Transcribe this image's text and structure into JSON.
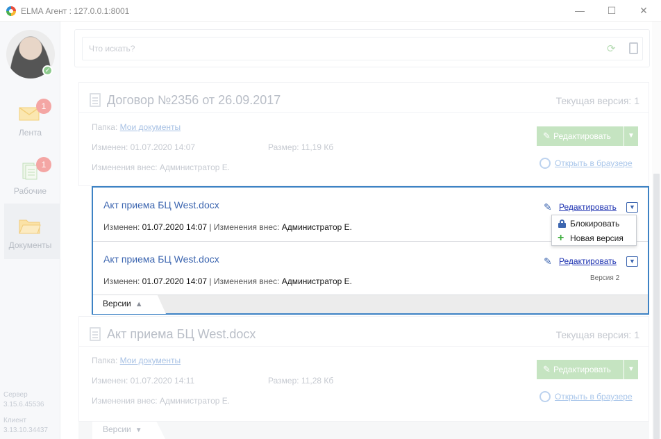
{
  "window": {
    "title": "ELMA Агент : 127.0.0.1:8001",
    "minimize": "—",
    "maximize": "☐",
    "close": "✕"
  },
  "sidebar": {
    "items": [
      {
        "label": "Лента",
        "badge": "1",
        "icon": "feed-envelope-icon"
      },
      {
        "label": "Рабочие",
        "badge": "1",
        "icon": "work-documents-icon"
      },
      {
        "label": "Документы",
        "icon": "folder-icon"
      }
    ],
    "server_label": "Сервер",
    "server_version": "3.15.6.45536",
    "client_label": "Клиент",
    "client_version": "3.13.10.34437"
  },
  "search": {
    "placeholder": "Что искать?"
  },
  "documents": [
    {
      "title": "Договор №2356 от 26.09.2017",
      "version_text": "Текущая версия: 1",
      "folder_label": "Папка:",
      "folder_link": "Мои документы",
      "changed_label": "Изменен:",
      "changed_value": "01.07.2020 14:07",
      "size_label": "Размер:",
      "size_value": "11,19 Кб",
      "author_label": "Изменения внес:",
      "author_value": "Администратор Е.",
      "edit_label": "Редактировать",
      "open_browser": "Открыть в браузере"
    },
    {
      "title": "Акт приема БЦ West.docx",
      "version_text": "Текущая версия: 1",
      "folder_label": "Папка:",
      "folder_link": "Мои документы",
      "changed_label": "Изменен:",
      "changed_value": "01.07.2020 14:11",
      "size_label": "Размер:",
      "size_value": "11,28 Кб",
      "author_label": "Изменения внес:",
      "author_value": "Администратор Е.",
      "edit_label": "Редактировать",
      "open_browser": "Открыть в браузере"
    }
  ],
  "versions": {
    "rows": [
      {
        "name": "Акт приема БЦ West.docx",
        "changed_label": "Изменен:",
        "changed_value": "01.07.2020 14:07",
        "author_label": "| Изменения внес:",
        "author_value": "Администратор Е.",
        "edit_label": "Редактировать",
        "version": ""
      },
      {
        "name": "Акт приема БЦ West.docx",
        "changed_label": "Изменен:",
        "changed_value": "01.07.2020 14:07",
        "author_label": "| Изменения внес:",
        "author_value": "Администратор Е.",
        "edit_label": "Редактировать",
        "version": "Версия 2"
      }
    ],
    "tab_label": "Версии",
    "dropdown": {
      "items": [
        {
          "label": "Блокировать",
          "icon": "lock-icon"
        },
        {
          "label": "Новая версия",
          "icon": "plus-icon"
        }
      ]
    },
    "bottom_tab_label": "Версии"
  },
  "colors": {
    "accent": "#3d82c4",
    "link": "#3d66b0",
    "green": "#3fae3f",
    "badge": "#f4a6a4"
  }
}
